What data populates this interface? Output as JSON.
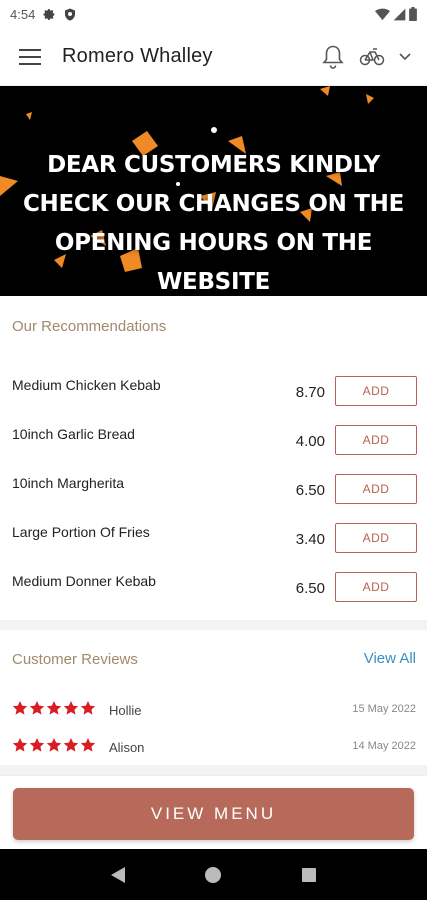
{
  "status_bar": {
    "time": "4:54",
    "icons": [
      "gear-icon",
      "shield-icon",
      "wifi-icon",
      "signal-icon",
      "battery-icon"
    ]
  },
  "app_bar": {
    "title": "Romero Whalley",
    "icons": [
      "hamburger-menu-icon",
      "bell-icon",
      "bicycle-icon",
      "chevron-down-icon"
    ]
  },
  "banner": {
    "lines": [
      "DEAR CUSTOMERS KINDLY",
      "CHECK OUR CHANGES ON THE",
      "OPENING HOURS ON THE",
      "WEBSITE"
    ],
    "background_color": "#000000",
    "confetti_color": "#f08a24"
  },
  "recommendations": {
    "title": "Our Recommendations",
    "add_label": "ADD",
    "items": [
      {
        "name": "Medium Chicken Kebab",
        "price": "8.70"
      },
      {
        "name": "10inch Garlic Bread",
        "price": "4.00"
      },
      {
        "name": "10inch Margherita",
        "price": "6.50"
      },
      {
        "name": "Large Portion Of Fries",
        "price": "3.40"
      },
      {
        "name": "Medium Donner Kebab",
        "price": "6.50"
      }
    ]
  },
  "reviews": {
    "title": "Customer Reviews",
    "view_all": "View All",
    "items": [
      {
        "name": "Hollie",
        "date": "15 May 2022",
        "rating": 5
      },
      {
        "name": "Alison",
        "date": "14 May 2022",
        "rating": 5
      }
    ]
  },
  "view_menu": {
    "label": "VIEW MENU"
  },
  "nav_bar": {
    "icons": [
      "back-icon",
      "home-icon",
      "recents-icon"
    ]
  },
  "colors": {
    "accent": "#b86a5a",
    "section_title": "#a08a6b",
    "link": "#3b8fc4",
    "star": "#d81e24"
  }
}
